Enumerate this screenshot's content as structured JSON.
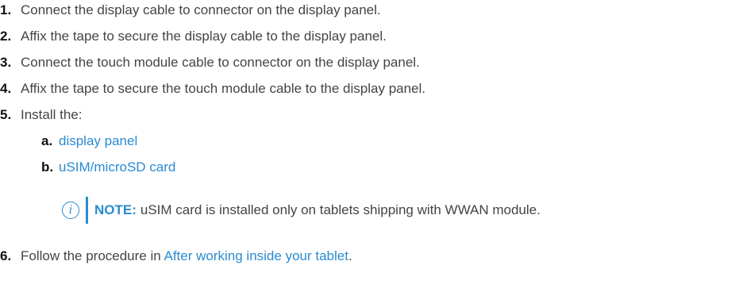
{
  "steps": [
    {
      "number": "1.",
      "text": "Connect the display cable to connector on the display panel."
    },
    {
      "number": "2.",
      "text": "Affix the tape to secure the display cable to the display panel."
    },
    {
      "number": "3.",
      "text": "Connect the touch module cable to connector on the display panel."
    },
    {
      "number": "4.",
      "text": "Affix the tape to secure the touch module cable to the display panel."
    },
    {
      "number": "5.",
      "text": "Install the:"
    },
    {
      "number": "6.",
      "text_before": "Follow the procedure in ",
      "link": "After working inside your tablet",
      "text_after": "."
    }
  ],
  "substeps": [
    {
      "letter": "a.",
      "link": "display panel"
    },
    {
      "letter": "b.",
      "link": "uSIM/microSD card"
    }
  ],
  "note": {
    "icon": "info-icon",
    "label": "NOTE:",
    "text": " uSIM card is installed only on tablets shipping with WWAN module."
  },
  "colors": {
    "link": "#2a8bd0",
    "text": "#444444",
    "number": "#111111"
  }
}
